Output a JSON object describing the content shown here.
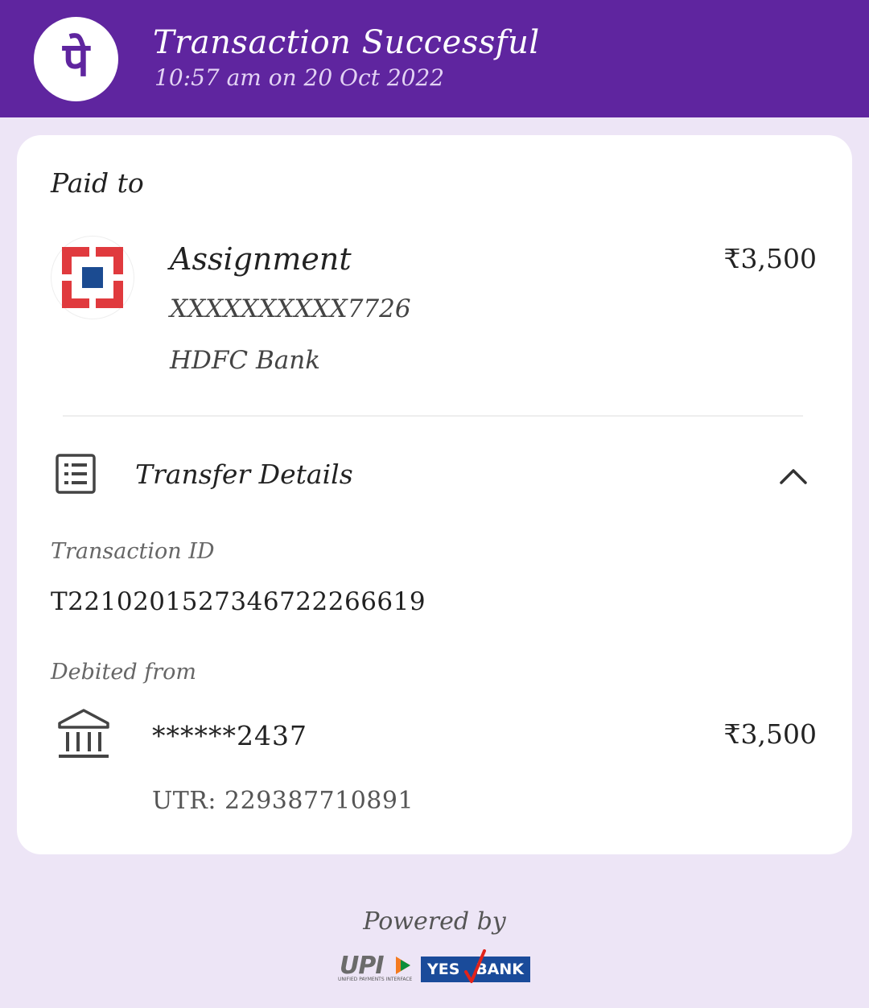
{
  "header": {
    "title": "Transaction Successful",
    "subtitle": "10:57 am on 20 Oct 2022",
    "logo_glyph": "पे",
    "accent": "#5f259f"
  },
  "payee": {
    "section_label": "Paid to",
    "name": "Assignment",
    "account": "XXXXXXXXXX7726",
    "bank": "HDFC Bank",
    "amount": "₹3,500"
  },
  "transfer_details": {
    "title": "Transfer Details",
    "transaction_id_label": "Transaction ID",
    "transaction_id": "T2210201527346722266619",
    "debited_from_label": "Debited from",
    "debit_account": "******2437",
    "debit_amount": "₹3,500",
    "utr": "UTR: 229387710891"
  },
  "footer": {
    "powered_by": "Powered by",
    "upi_text": "UPI",
    "upi_subtext": "UNIFIED PAYMENTS INTERFACE",
    "yes_left": "YES",
    "yes_right": "BANK"
  }
}
